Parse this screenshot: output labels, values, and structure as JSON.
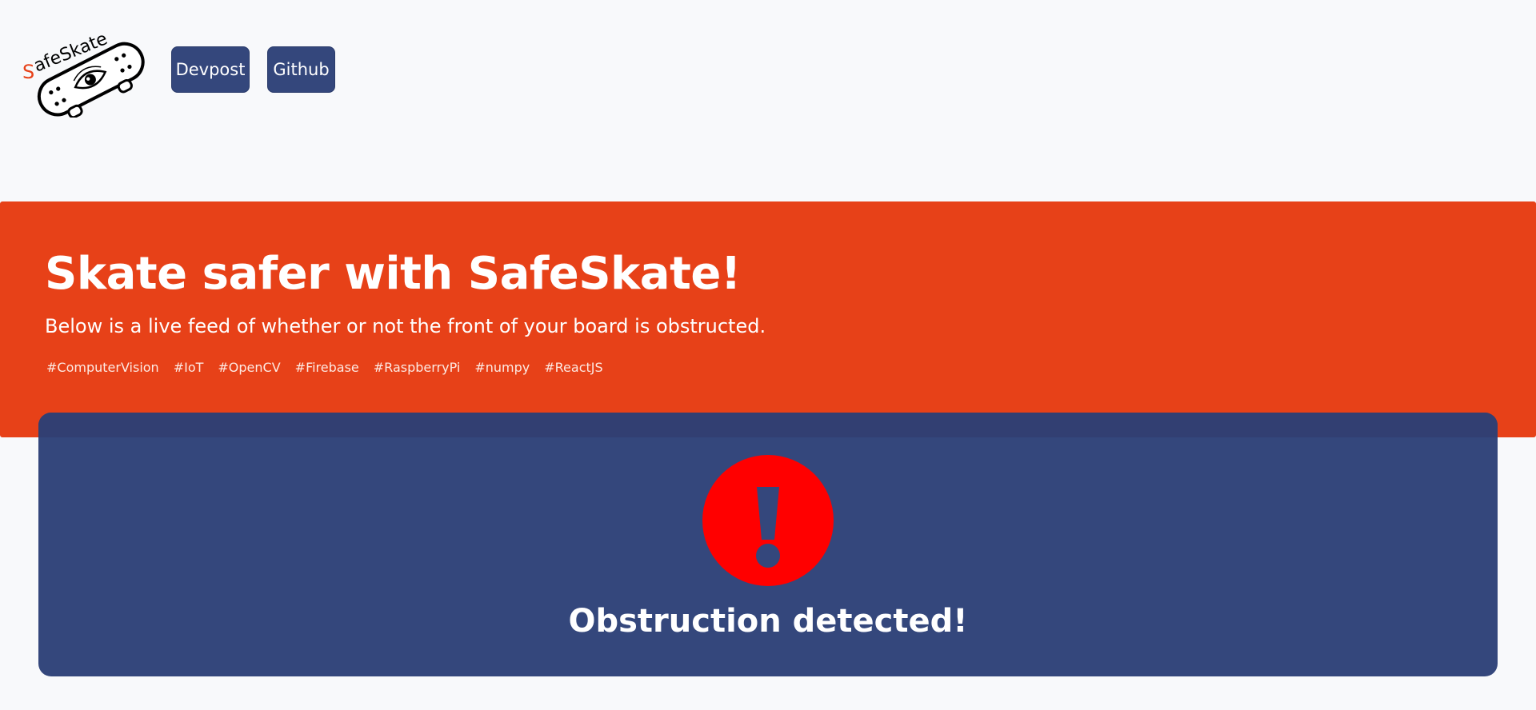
{
  "header": {
    "logo_text": "SafeSkate",
    "nav": [
      {
        "label": "Devpost"
      },
      {
        "label": "Github"
      }
    ]
  },
  "hero": {
    "title": "Skate safer with SafeSkate!",
    "subtitle": "Below is a live feed of whether or not the front of your board is obstructed.",
    "tags": [
      "#ComputerVision",
      "#IoT",
      "#OpenCV",
      "#Firebase",
      "#RaspberryPi",
      "#numpy",
      "#ReactJS"
    ]
  },
  "status_panel": {
    "icon": "exclamation-circle-icon",
    "message": "Obstruction detected!"
  },
  "colors": {
    "background": "#f8f9fb",
    "hero_orange": "#e74118",
    "panel_navy": "#34477c",
    "button_navy": "#34477c",
    "alert_red": "#ff0000"
  }
}
